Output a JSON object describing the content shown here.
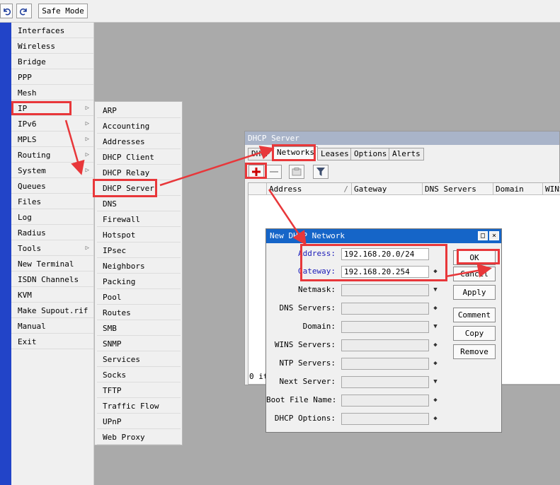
{
  "toolbar": {
    "undo_icon": "undo-icon",
    "redo_icon": "redo-icon",
    "safe_mode": "Safe Mode"
  },
  "main_menu": [
    {
      "label": "Interfaces"
    },
    {
      "label": "Wireless"
    },
    {
      "label": "Bridge"
    },
    {
      "label": "PPP"
    },
    {
      "label": "Mesh"
    },
    {
      "label": "IP",
      "submenu": true
    },
    {
      "label": "IPv6",
      "submenu": true
    },
    {
      "label": "MPLS",
      "submenu": true
    },
    {
      "label": "Routing",
      "submenu": true
    },
    {
      "label": "System",
      "submenu": true
    },
    {
      "label": "Queues"
    },
    {
      "label": "Files"
    },
    {
      "label": "Log"
    },
    {
      "label": "Radius"
    },
    {
      "label": "Tools",
      "submenu": true
    },
    {
      "label": "New Terminal"
    },
    {
      "label": "ISDN Channels"
    },
    {
      "label": "KVM"
    },
    {
      "label": "Make Supout.rif"
    },
    {
      "label": "Manual"
    },
    {
      "label": "Exit"
    }
  ],
  "ip_submenu": [
    "ARP",
    "Accounting",
    "Addresses",
    "DHCP Client",
    "DHCP Relay",
    "DHCP Server",
    "DNS",
    "Firewall",
    "Hotspot",
    "IPsec",
    "Neighbors",
    "Packing",
    "Pool",
    "Routes",
    "SMB",
    "SNMP",
    "Services",
    "Socks",
    "TFTP",
    "Traffic Flow",
    "UPnP",
    "Web Proxy"
  ],
  "dhcp_window": {
    "title": "DHCP Server",
    "tabs": [
      "DHCP",
      "Networks",
      "Leases",
      "Options",
      "Alerts"
    ],
    "active_tab": "Networks",
    "columns": [
      "Address",
      "Gateway",
      "DNS Servers",
      "Domain",
      "WINS"
    ],
    "status": "0 it"
  },
  "dialog": {
    "title": "New DHCP Network",
    "fields": [
      {
        "label": "Address:",
        "value": "192.168.20.0/24"
      },
      {
        "label": "Gateway:",
        "value": "192.168.20.254"
      },
      {
        "label": "Netmask:",
        "value": ""
      },
      {
        "label": "DNS Servers:",
        "value": ""
      },
      {
        "label": "Domain:",
        "value": ""
      },
      {
        "label": "WINS Servers:",
        "value": ""
      },
      {
        "label": "NTP Servers:",
        "value": ""
      },
      {
        "label": "Next Server:",
        "value": ""
      },
      {
        "label": "Boot File Name:",
        "value": ""
      },
      {
        "label": "DHCP Options:",
        "value": ""
      }
    ],
    "buttons": [
      "OK",
      "Cancel",
      "Apply",
      "Comment",
      "Copy",
      "Remove"
    ]
  },
  "colors": {
    "annotation_red": "#e8373a",
    "dialog_title": "#1565c8",
    "left_bar": "#2244c8"
  }
}
